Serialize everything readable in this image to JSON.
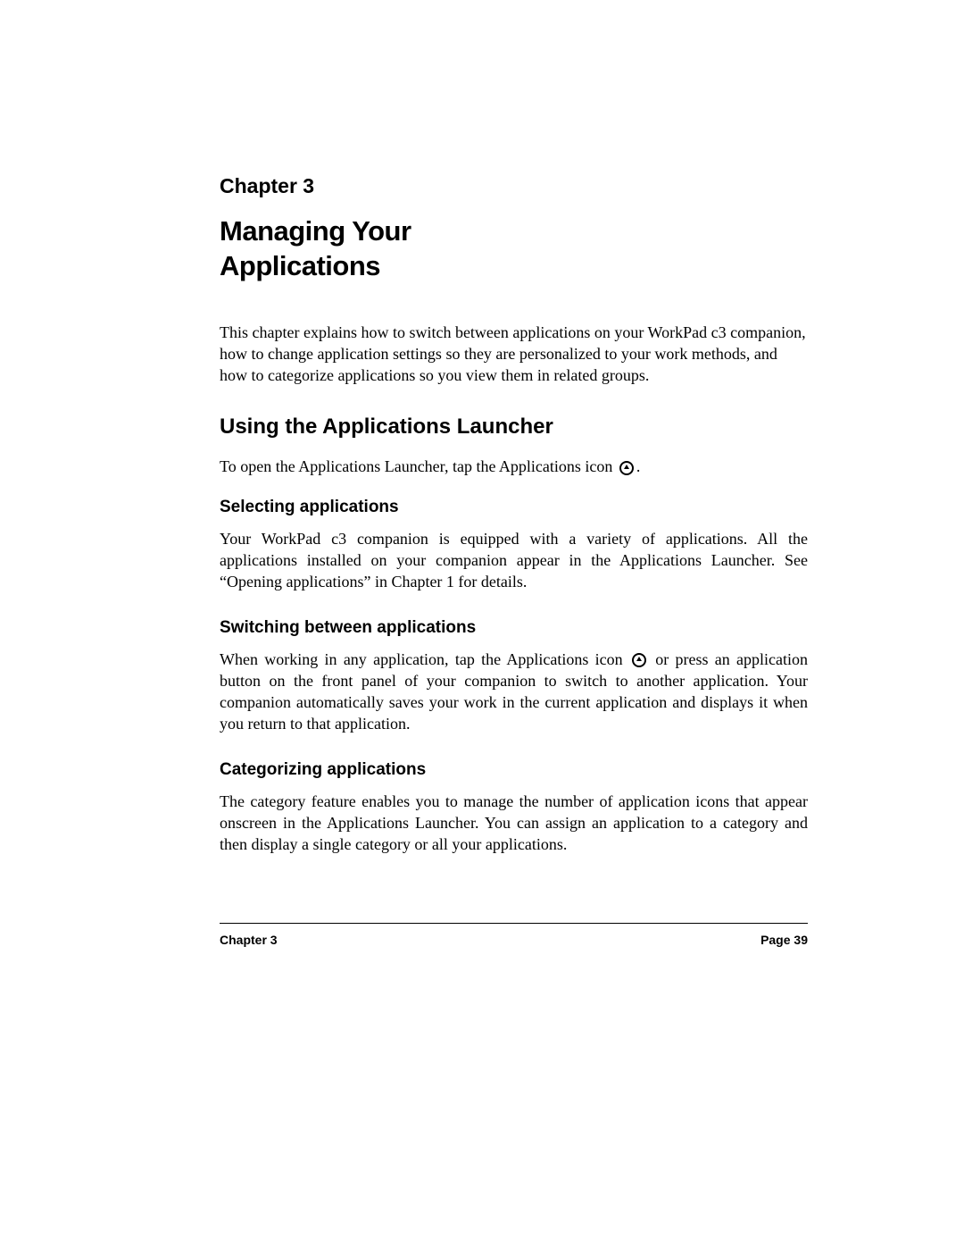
{
  "chapter": {
    "label": "Chapter 3",
    "title_line1": "Managing Your",
    "title_line2": "Applications",
    "intro": "This chapter explains how to switch between applications on your WorkPad c3 companion, how to change application settings so they are personalized to your work methods, and how to categorize applications so you view them in related groups."
  },
  "section1": {
    "heading": "Using the Applications Launcher",
    "text_before_icon": "To open the Applications Launcher, tap the Applications icon ",
    "text_after_icon": "."
  },
  "subsection1": {
    "heading": "Selecting applications",
    "text": "Your WorkPad c3 companion is equipped with a variety of applications. All the applications installed on your companion appear in the Applications Launcher. See “Opening applications” in Chapter 1 for details."
  },
  "subsection2": {
    "heading": "Switching between applications",
    "text_before_icon": "When working in any application, tap the Applications icon ",
    "text_after_icon": " or press an application button on the front panel of your companion to switch to another application. Your companion automatically saves your work in the current application and displays it when you return to that application."
  },
  "subsection3": {
    "heading": "Categorizing applications",
    "text": "The category feature enables you to manage the number of application icons that appear onscreen in the Applications Launcher. You can assign an application to a category and then display a single category or all your applications."
  },
  "footer": {
    "left": "Chapter 3",
    "right": "Page 39"
  }
}
